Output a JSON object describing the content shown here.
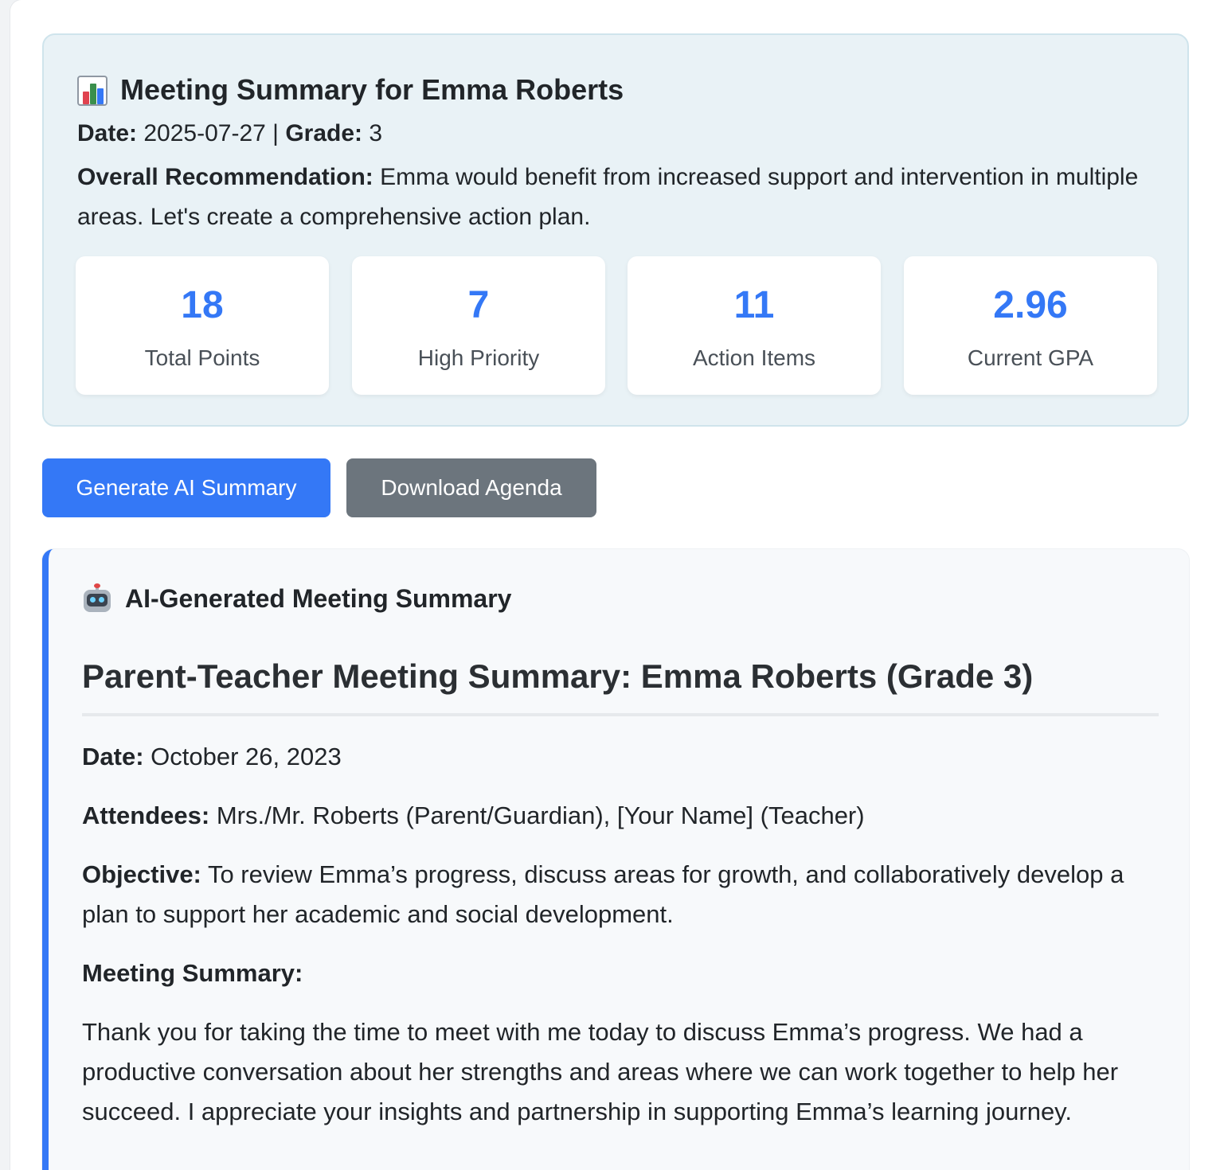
{
  "summary": {
    "title": "Meeting Summary for Emma Roberts",
    "date_label": "Date:",
    "date_value": "2025-07-27",
    "separator": "|",
    "grade_label": "Grade:",
    "grade_value": "3",
    "recommendation_label": "Overall Recommendation:",
    "recommendation_text": "Emma would benefit from increased support and intervention in multiple areas. Let's create a comprehensive action plan."
  },
  "stats": [
    {
      "value": "18",
      "label": "Total Points"
    },
    {
      "value": "7",
      "label": "High Priority"
    },
    {
      "value": "11",
      "label": "Action Items"
    },
    {
      "value": "2.96",
      "label": "Current GPA"
    }
  ],
  "buttons": {
    "generate": "Generate AI Summary",
    "download": "Download Agenda"
  },
  "ai_summary": {
    "heading": "AI-Generated Meeting Summary",
    "doc_title": "Parent-Teacher Meeting Summary: Emma Roberts (Grade 3)",
    "date_label": "Date:",
    "date_value": "October 26, 2023",
    "attendees_label": "Attendees:",
    "attendees_value": "Mrs./Mr. Roberts (Parent/Guardian), [Your Name] (Teacher)",
    "objective_label": "Objective:",
    "objective_value": "To review Emma’s progress, discuss areas for growth, and collaboratively develop a plan to support her academic and social development.",
    "meeting_summary_label": "Meeting Summary:",
    "body": "Thank you for taking the time to meet with me today to discuss Emma’s progress. We had a productive conversation about her strengths and areas where we can work together to help her succeed. I appreciate your insights and partnership in supporting Emma’s learning journey."
  },
  "colors": {
    "accent": "#3478f6",
    "secondary": "#6c757d",
    "panel": "#e9f2f6"
  }
}
